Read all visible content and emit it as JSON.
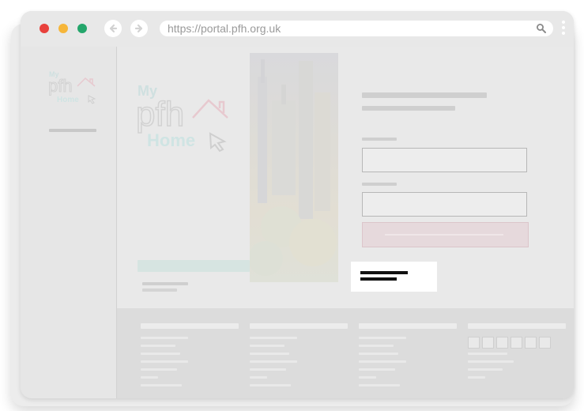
{
  "browser": {
    "url": "https://portal.pfh.org.uk",
    "traffic_lights": {
      "close": "#e8413c",
      "minimize": "#f6b63a",
      "zoom": "#24a66b"
    }
  },
  "branding": {
    "logo_text": {
      "my": "My",
      "pfh": "pfh",
      "home": "Home"
    },
    "colors": {
      "my": "#cfe0e0",
      "pfh": "#d6d6d6",
      "home": "#cfe4e3",
      "roof": "#e7c9cf",
      "cursor": "#cfcfcf"
    }
  },
  "icons": {
    "back": "arrow-left-icon",
    "forward": "arrow-right-icon",
    "search": "magnifier-icon",
    "menu": "kebab-menu-icon",
    "cursor": "mouse-pointer-icon"
  },
  "accents": {
    "primary_button_fill": "#e6d9dc",
    "teal_banner": "#d6e4e1"
  }
}
